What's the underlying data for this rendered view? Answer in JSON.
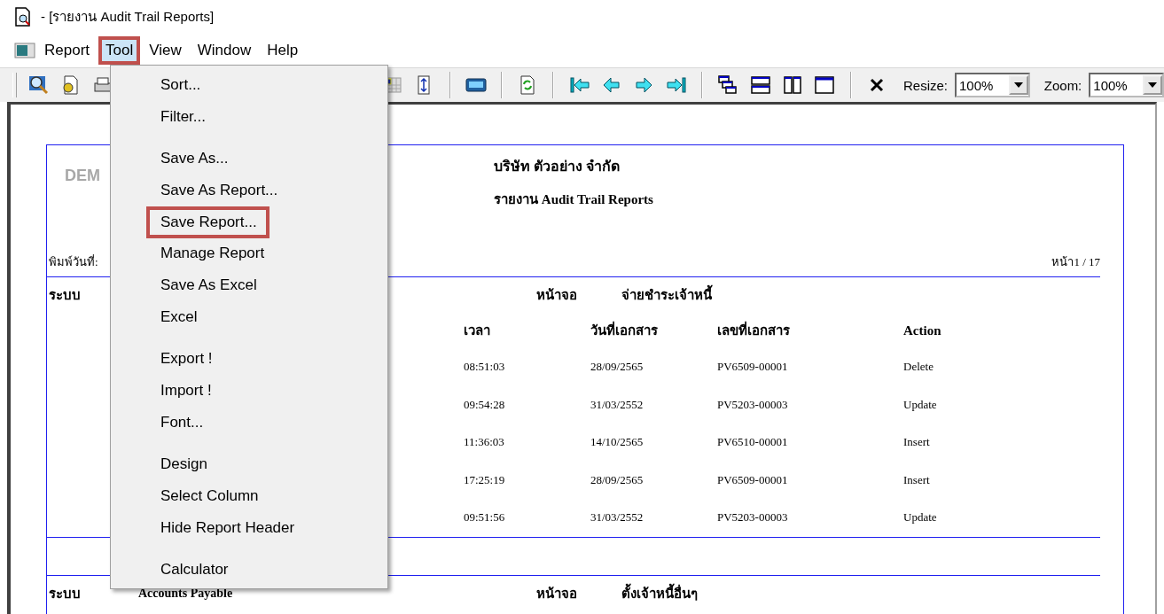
{
  "window": {
    "title": "- [รายงาน Audit Trail Reports]"
  },
  "menu_bar": [
    {
      "label": "Report",
      "selected": false,
      "highlighted": false
    },
    {
      "label": "Tool",
      "selected": true,
      "highlighted": true
    },
    {
      "label": "View",
      "selected": false,
      "highlighted": false
    },
    {
      "label": "Window",
      "selected": false,
      "highlighted": false
    },
    {
      "label": "Help",
      "selected": false,
      "highlighted": false
    }
  ],
  "toolbar": {
    "resize": {
      "label": "Resize:",
      "value": "100%"
    },
    "zoom": {
      "label": "Zoom:",
      "value": "100%"
    }
  },
  "tool_menu": {
    "groups": [
      [
        {
          "label": "Sort...",
          "highlighted": false
        },
        {
          "label": "Filter...",
          "highlighted": false
        }
      ],
      [
        {
          "label": "Save As...",
          "highlighted": false
        },
        {
          "label": "Save As Report...",
          "highlighted": false
        },
        {
          "label": "Save Report...",
          "highlighted": true
        },
        {
          "label": "Manage Report",
          "highlighted": false
        },
        {
          "label": "Save As Excel",
          "highlighted": false
        },
        {
          "label": "Excel",
          "highlighted": false
        }
      ],
      [
        {
          "label": "Export !",
          "highlighted": false
        },
        {
          "label": "Import !",
          "highlighted": false
        },
        {
          "label": "Font...",
          "highlighted": false
        }
      ],
      [
        {
          "label": "Design",
          "highlighted": false
        },
        {
          "label": "Select Column",
          "highlighted": false
        },
        {
          "label": "Hide Report Header",
          "highlighted": false
        }
      ],
      [
        {
          "label": "Calculator",
          "highlighted": false
        }
      ]
    ]
  },
  "report": {
    "watermark": "DEM",
    "company": "บริษัท ตัวอย่าง จำกัด",
    "title": "รายงาน Audit Trail Reports",
    "print_date_label": "พิมพ์วันที่:",
    "page": "หน้า1 / 17",
    "sections": [
      {
        "system_label": "ระบบ",
        "screen_label": "หน้าจอ",
        "screen": "จ่ายชำระเจ้าหนี้",
        "columns": [
          "เวลา",
          "วันที่เอกสาร",
          "เลขที่เอกสาร",
          "Action"
        ],
        "rows": [
          [
            "08:51:03",
            "28/09/2565",
            "PV6509-00001",
            "Delete"
          ],
          [
            "09:54:28",
            "31/03/2552",
            "PV5203-00003",
            "Update"
          ],
          [
            "11:36:03",
            "14/10/2565",
            "PV6510-00001",
            "Insert"
          ],
          [
            "17:25:19",
            "28/09/2565",
            "PV6509-00001",
            "Insert"
          ],
          [
            "09:51:56",
            "31/03/2552",
            "PV5203-00003",
            "Update"
          ]
        ]
      },
      {
        "system_label": "ระบบ",
        "system": "Accounts Payable",
        "screen_label": "หน้าจอ",
        "screen": "ตั้งเจ้าหนี้อื่นๆ"
      }
    ]
  }
}
